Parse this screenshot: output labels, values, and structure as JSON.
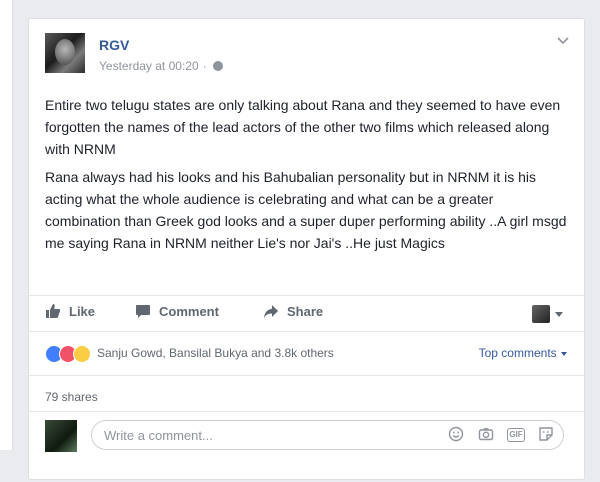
{
  "post": {
    "author": "RGV",
    "timestamp": "Yesterday at 00:20",
    "separator": "·",
    "paragraphs": [
      "Entire two telugu states are only talking about Rana and they seemed to have even forgotten the names of the lead actors of the other two films which released along with NRNM",
      "Rana always had his looks and his Bahubalian personality but in NRNM it is his acting what the whole audience is celebrating and what can be a greater combination than Greek god looks and a super duper performing ability ..A girl msgd me saying Rana in NRNM neither Lie's nor Jai's ..He just Magics"
    ]
  },
  "actions": {
    "like_label": "Like",
    "comment_label": "Comment",
    "share_label": "Share"
  },
  "reactions": {
    "summary": "Sanju Gowd, Bansilal Bukya and 3.8k others",
    "top_comments_label": "Top comments"
  },
  "shares": {
    "label": "79 shares"
  },
  "composer": {
    "placeholder": "Write a comment...",
    "gif_label": "GIF"
  },
  "colors": {
    "link_blue": "#365899",
    "like_blue": "#4080ff",
    "love_red": "#f25268",
    "haha_yellow": "#fbcd44"
  }
}
